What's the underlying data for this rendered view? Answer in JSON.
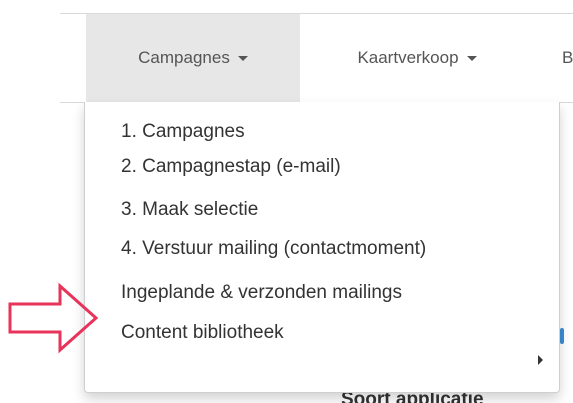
{
  "navbar": {
    "items": [
      {
        "label": "Campagnes",
        "active": true
      },
      {
        "label": "Kaartverkoop",
        "active": false
      },
      {
        "label": "B",
        "active": false
      }
    ]
  },
  "dropdown": {
    "items": [
      {
        "label": "1. Campagnes"
      },
      {
        "label": "2. Campagnestap (e-mail)"
      },
      {
        "label": "3. Maak selectie"
      },
      {
        "label": "4. Verstuur mailing (contactmoment)"
      },
      {
        "label": "Ingeplande & verzonden mailings"
      },
      {
        "label": "Content bibliotheek",
        "has_submenu": true
      }
    ]
  },
  "background": {
    "heading": "Soort applicatie"
  },
  "annotation": {
    "icon": "right-arrow-outline",
    "color": "#e8335a"
  },
  "colors": {
    "active_tab_bg": "#e7e7e7",
    "nav_text": "#555555",
    "menu_text": "#333333"
  }
}
